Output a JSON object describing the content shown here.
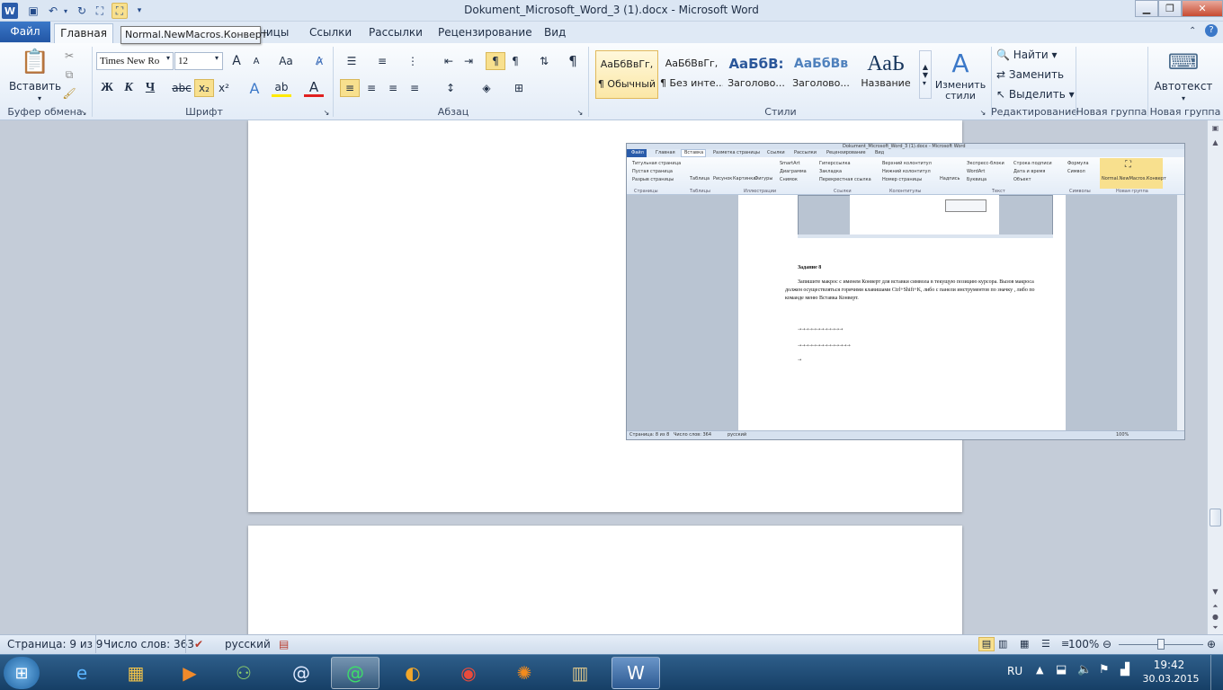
{
  "window": {
    "title": "Dokument_Microsoft_Word_3 (1).docx - Microsoft Word",
    "tooltip": "Normal.NewMacros.Конверт"
  },
  "tabs": {
    "file": "Файл",
    "home": "Главная",
    "items": [
      "Разметка страницы",
      "Ссылки",
      "Рассылки",
      "Рецензирование",
      "Вид"
    ],
    "hidden_suffix": "ницы"
  },
  "ribbon": {
    "clipboard": {
      "paste": "Вставить",
      "label": "Буфер обмена"
    },
    "font": {
      "name": "Times New Ro",
      "size": "12",
      "label": "Шрифт",
      "bold": "Ж",
      "italic": "К",
      "underline": "Ч",
      "strike": "abc",
      "sub": "x₂",
      "sup": "x²",
      "grow": "A",
      "shrink": "A",
      "case": "Aa"
    },
    "paragraph": {
      "label": "Абзац"
    },
    "styles": {
      "label": "Стили",
      "items": [
        {
          "sample": "АаБбВвГг,",
          "name": "¶ Обычный"
        },
        {
          "sample": "АаБбВвГг,",
          "name": "¶ Без инте..."
        },
        {
          "sample": "АаБбВ:",
          "name": "Заголово..."
        },
        {
          "sample": "АаБбВв",
          "name": "Заголово..."
        },
        {
          "sample": "АаЬ",
          "name": "Название"
        }
      ],
      "change": "Изменить стили"
    },
    "editing": {
      "find": "Найти",
      "replace": "Заменить",
      "select": "Выделить",
      "label": "Редактирование"
    },
    "new_group_1": "Новая группа",
    "new_group_2": "Новая группа",
    "autotext": "Автотекст"
  },
  "embedded": {
    "title": "Dokument_Microsoft_Word_3 (1).docx - Microsoft Word",
    "tabs": [
      "Файл",
      "Главная",
      "Вставка",
      "Разметка страницы",
      "Ссылки",
      "Рассылки",
      "Рецензирование",
      "Вид"
    ],
    "pages_group": [
      "Титульная страница",
      "Пустая страница",
      "Разрыв страницы"
    ],
    "group_labels": [
      "Страницы",
      "Таблицы",
      "Иллюстрации",
      "Ссылки",
      "Колонтитулы",
      "Текст",
      "Символы",
      "Новая группа"
    ],
    "table": "Таблица",
    "illustrations": [
      "Рисунок",
      "Картинка",
      "Фигуры",
      "SmartArt",
      "Диаграмма",
      "Снимок"
    ],
    "links": [
      "Гиперссылка",
      "Закладка",
      "Перекрестная ссылка"
    ],
    "headers": [
      "Верхний колонтитул",
      "Нижний колонтитул",
      "Номер страницы"
    ],
    "text": [
      "Надпись",
      "Экспресс-блоки",
      "WordArt",
      "Буквица",
      "Строка подписи",
      "Дата и время",
      "Объект"
    ],
    "symbols": [
      "Формула",
      "Символ"
    ],
    "macro": "Normal.NewMacros.Конверт",
    "heading": "Задание 8",
    "para": "Запишите макрос с именем Конверт для вставки символа  в текущую позицию курсора. Вызов макроса должен осуществляться горячими клавишами Ctrl+Shift+K, либо с панели инструментов по значку , либо по команде меню Вставка Конверт.",
    "status": [
      "Страница: 8 из 8",
      "Число слов: 364",
      "русский"
    ],
    "zoom": "100%"
  },
  "status": {
    "page": "Страница: 9 из 9",
    "words": "Число слов: 363",
    "lang": "русский",
    "zoom": "100%"
  },
  "taskbar": {
    "lang": "RU",
    "time": "19:42",
    "date": "30.03.2015"
  },
  "colors": {
    "accent": "#2a5caa",
    "ribbon": "#e3ecf7",
    "taskbar": "#1d4a73"
  }
}
